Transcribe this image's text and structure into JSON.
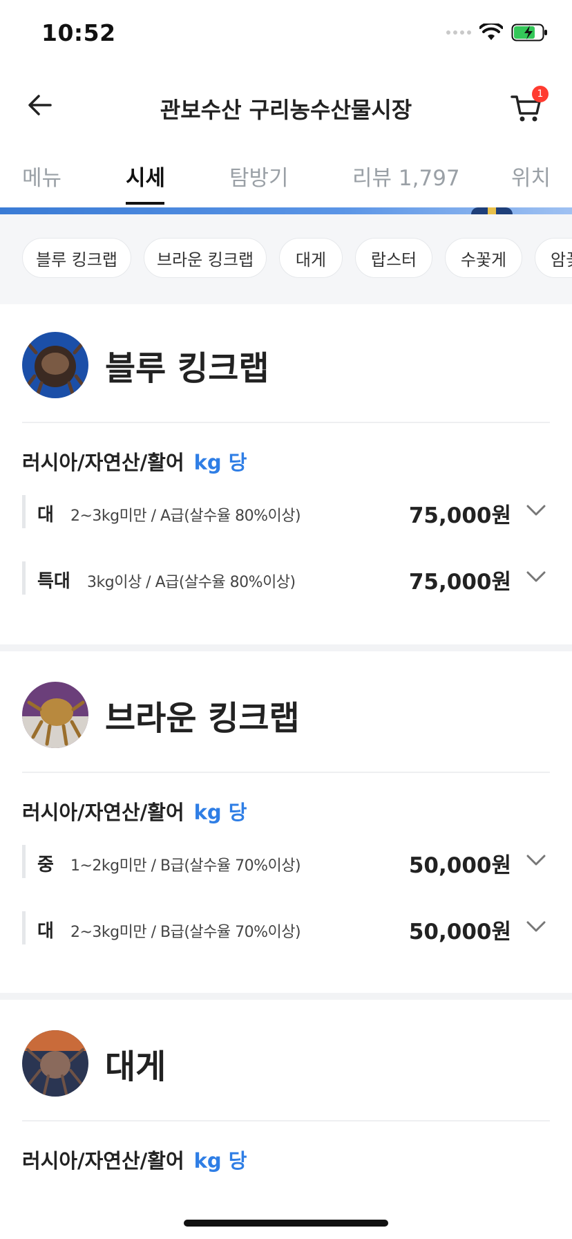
{
  "status_bar": {
    "time": "10:52"
  },
  "header": {
    "title": "관보수산 구리농수산물시장",
    "cart_badge": "1"
  },
  "tabs": [
    {
      "label": "메뉴"
    },
    {
      "label": "시세"
    },
    {
      "label": "탐방기"
    },
    {
      "label": "리뷰 1,797"
    },
    {
      "label": "위치"
    }
  ],
  "active_tab": "시세",
  "chips": [
    {
      "label": "블루 킹크랩"
    },
    {
      "label": "브라운 킹크랩"
    },
    {
      "label": "대게"
    },
    {
      "label": "랍스터"
    },
    {
      "label": "수꽃게"
    },
    {
      "label": "암꽃게"
    }
  ],
  "sections": [
    {
      "title": "블루 킹크랩",
      "origin": "러시아/자연산/활어",
      "unit": "kg 당",
      "rows": [
        {
          "grade": "대",
          "desc": "2~3kg미만 / A급(살수율 80%이상)",
          "price": "75,000원"
        },
        {
          "grade": "특대",
          "desc": "3kg이상 / A급(살수율 80%이상)",
          "price": "75,000원"
        }
      ]
    },
    {
      "title": "브라운 킹크랩",
      "origin": "러시아/자연산/활어",
      "unit": "kg 당",
      "rows": [
        {
          "grade": "중",
          "desc": "1~2kg미만 / B급(살수율 70%이상)",
          "price": "50,000원"
        },
        {
          "grade": "대",
          "desc": "2~3kg미만 / B급(살수율 70%이상)",
          "price": "50,000원"
        }
      ]
    },
    {
      "title": "대게",
      "origin": "러시아/자연산/활어",
      "unit": "kg 당",
      "rows": []
    }
  ],
  "colors": {
    "accent": "#2f7ee5",
    "badge": "#ff3b30",
    "battery": "#34c759"
  }
}
